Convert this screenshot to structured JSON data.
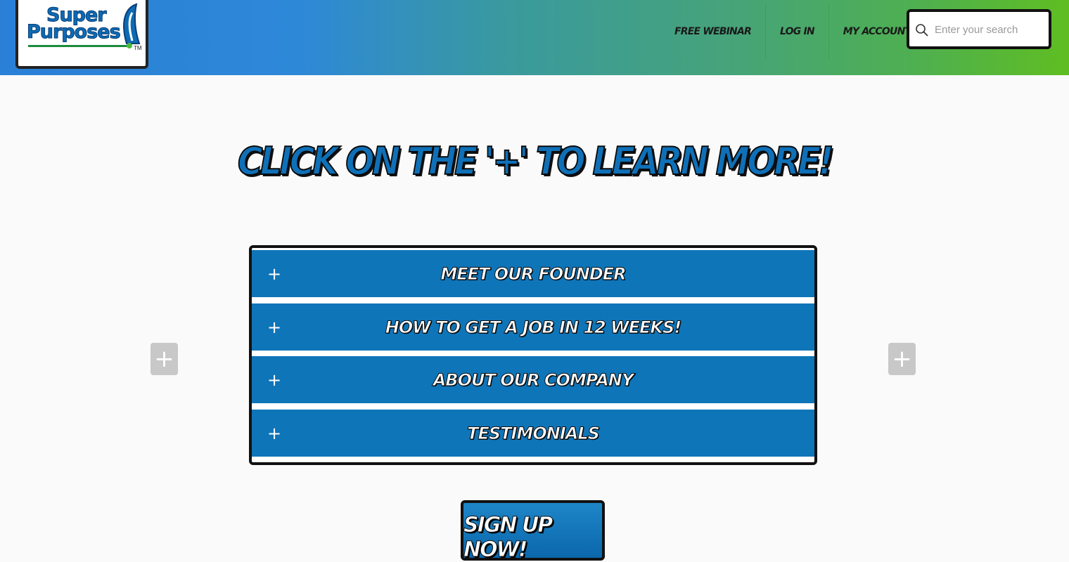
{
  "header": {
    "logo": {
      "line1": "Super",
      "line2": "Purposes",
      "tm": "TM"
    },
    "nav": [
      {
        "label": "FREE WEBINAR"
      },
      {
        "label": "LOG IN"
      },
      {
        "label": "MY ACCOUNT"
      }
    ],
    "search": {
      "placeholder": "Enter your search",
      "value": ""
    },
    "gradient_colors": [
      "#2a7fd6",
      "#5fbd22"
    ]
  },
  "main": {
    "headline": "CLICK ON THE '+' TO LEARN MORE!",
    "accordion": [
      {
        "icon": "+",
        "label": "MEET OUR FOUNDER"
      },
      {
        "icon": "+",
        "label": "HOW TO GET A JOB IN 12 WEEKS!"
      },
      {
        "icon": "+",
        "label": "ABOUT OUR COMPANY"
      },
      {
        "icon": "+",
        "label": "TESTIMONIALS"
      }
    ],
    "side_buttons": {
      "left": "+",
      "right": "+"
    },
    "signup_label": "SIGN UP NOW!",
    "accent_color": "#0f75b9"
  }
}
